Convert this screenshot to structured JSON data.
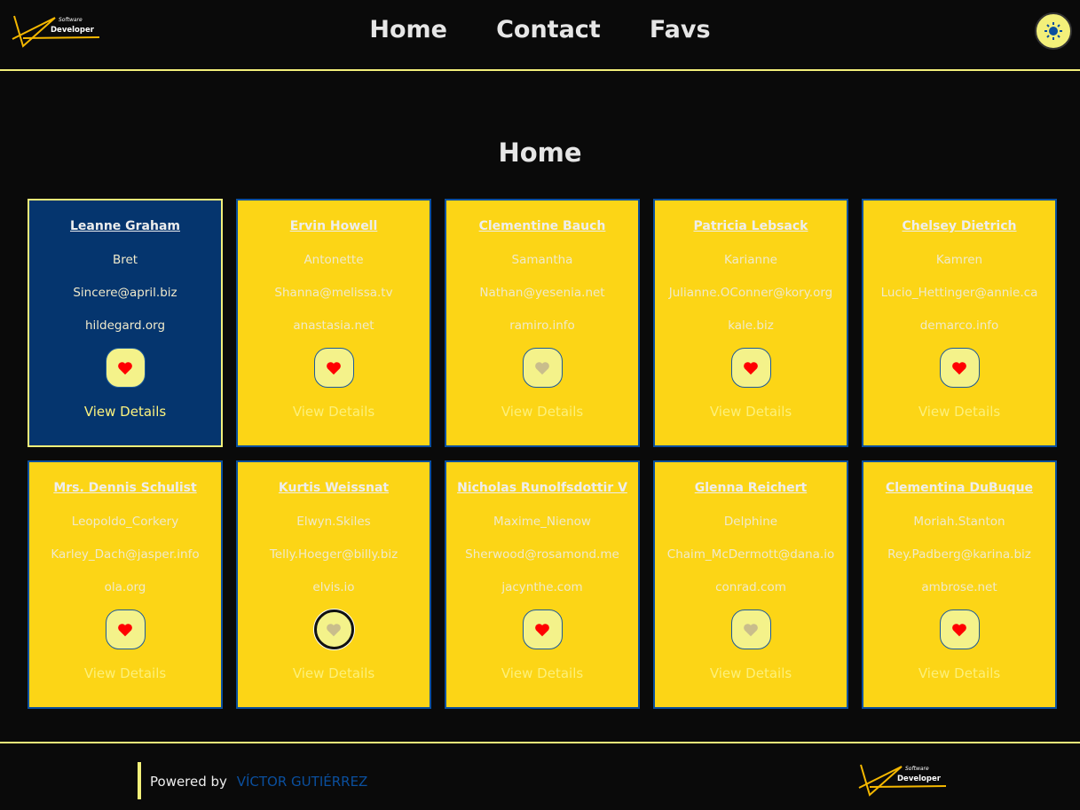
{
  "header": {
    "logo_small": "Software",
    "logo_big": "Developer",
    "nav": [
      "Home",
      "Contact",
      "Favs"
    ],
    "theme_icon": "sun-icon"
  },
  "page_title": "Home",
  "cards": [
    {
      "name": "Leanne Graham",
      "username": "Bret",
      "email": "Sincere@april.biz",
      "website": "hildegard.org",
      "fav": true,
      "active": true
    },
    {
      "name": "Ervin Howell",
      "username": "Antonette",
      "email": "Shanna@melissa.tv",
      "website": "anastasia.net",
      "fav": true
    },
    {
      "name": "Clementine Bauch",
      "username": "Samantha",
      "email": "Nathan@yesenia.net",
      "website": "ramiro.info",
      "fav": false
    },
    {
      "name": "Patricia Lebsack",
      "username": "Karianne",
      "email": "Julianne.OConner@kory.org",
      "website": "kale.biz",
      "fav": true
    },
    {
      "name": "Chelsey Dietrich",
      "username": "Kamren",
      "email": "Lucio_Hettinger@annie.ca",
      "website": "demarco.info",
      "fav": true
    },
    {
      "name": "Mrs. Dennis Schulist",
      "username": "Leopoldo_Corkery",
      "email": "Karley_Dach@jasper.info",
      "website": "ola.org",
      "fav": true
    },
    {
      "name": "Kurtis Weissnat",
      "username": "Elwyn.Skiles",
      "email": "Telly.Hoeger@billy.biz",
      "website": "elvis.io",
      "fav": false,
      "focused": true
    },
    {
      "name": "Nicholas Runolfsdottir V",
      "username": "Maxime_Nienow",
      "email": "Sherwood@rosamond.me",
      "website": "jacynthe.com",
      "fav": true
    },
    {
      "name": "Glenna Reichert",
      "username": "Delphine",
      "email": "Chaim_McDermott@dana.io",
      "website": "conrad.com",
      "fav": false
    },
    {
      "name": "Clementina DuBuque",
      "username": "Moriah.Stanton",
      "email": "Rey.Padberg@karina.biz",
      "website": "ambrose.net",
      "fav": true
    }
  ],
  "view_details_label": "View Details",
  "colors": {
    "fav": "#ff0000",
    "unfav": "#c9bd8c"
  },
  "footer": {
    "powered_by": "Powered by",
    "author": "VÍCTOR GUTIÉRREZ"
  }
}
